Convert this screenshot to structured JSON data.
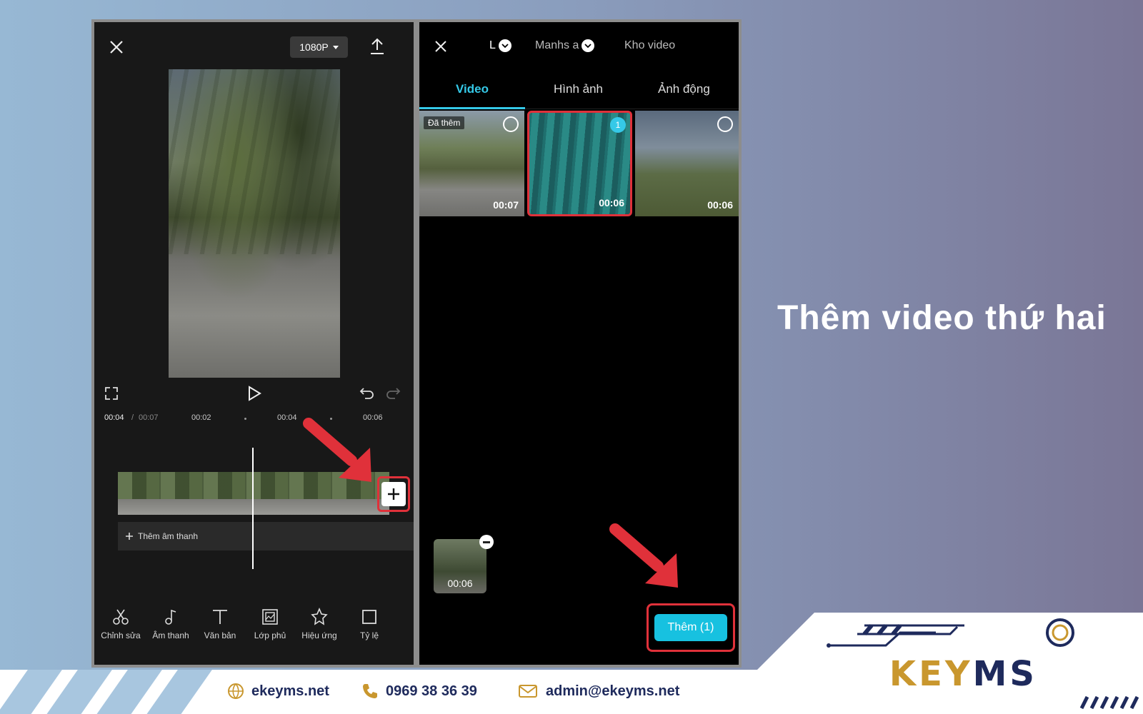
{
  "caption": "Thêm video thứ hai",
  "left_panel": {
    "resolution": "1080P",
    "ruler": {
      "current": "00:04",
      "separator": "/",
      "total": "00:07",
      "ticks": [
        "00:02",
        "00:04",
        "00:06"
      ]
    },
    "audio_label": "Thêm âm thanh",
    "tools": [
      {
        "label": "Chỉnh sửa",
        "icon": "scissors-icon"
      },
      {
        "label": "Âm thanh",
        "icon": "music-note-icon"
      },
      {
        "label": "Văn bản",
        "icon": "text-icon"
      },
      {
        "label": "Lớp phủ",
        "icon": "overlay-icon"
      },
      {
        "label": "Hiệu ứng",
        "icon": "effects-icon"
      },
      {
        "label": "Tỷ lệ",
        "icon": "ratio-icon"
      }
    ]
  },
  "right_panel": {
    "sources": [
      "L",
      "Manhs a",
      "Kho video"
    ],
    "media_tabs": [
      "Video",
      "Hình ảnh",
      "Ảnh động"
    ],
    "active_tab": "Video",
    "thumbnails": [
      {
        "badge": "Đã thêm",
        "duration": "00:07",
        "selected": false
      },
      {
        "badge": "",
        "duration": "00:06",
        "selected": true,
        "order": "1"
      },
      {
        "badge": "",
        "duration": "00:06",
        "selected": false
      }
    ],
    "selected_clip_duration": "00:06",
    "add_button": "Thêm (1)"
  },
  "footer": {
    "website": "ekeyms.net",
    "phone": "0969 38 36 39",
    "email": "admin@ekeyms.net",
    "logo_left": "KEY",
    "logo_right": "MS"
  },
  "colors": {
    "accent": "#35c9e8",
    "highlight": "#e0313a",
    "brand_navy": "#1e2a5c",
    "brand_gold": "#c9972e"
  }
}
